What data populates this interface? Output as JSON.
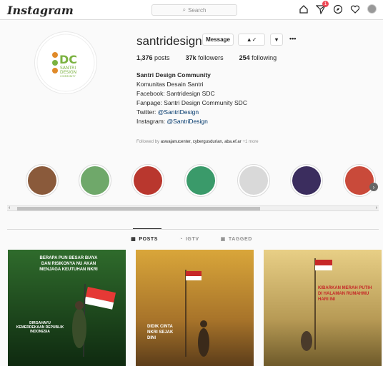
{
  "app": {
    "logo": "Instagram"
  },
  "search": {
    "placeholder": "Search"
  },
  "nav": {
    "activity_count": "1"
  },
  "profile": {
    "username": "santridesign",
    "message_label": "Message",
    "follow_icon_label": "▲✓",
    "more_label": "•••",
    "posts_count": "1,376",
    "posts_label": "posts",
    "followers_count": "37k",
    "followers_label": "followers",
    "following_count": "254",
    "following_label": "following",
    "bio": {
      "name": "Santri Design Community",
      "line1": "Komunitas Desain Santri",
      "line2": "Facebook: Santridesign SDC",
      "line3": "Fanpage: Santri Design Community SDC",
      "twitter_prefix": "Twitter: ",
      "twitter_handle": "@SantriDesign",
      "instagram_prefix": "Instagram: ",
      "instagram_handle": "@SantriDesign",
      "website": "santridesign.id"
    },
    "followed_prefix": "Followed by",
    "followed_users": "aswajanucenter, cybergusdurian, aba.ef.ar",
    "followed_more": "+1 more"
  },
  "highlights": [
    {
      "color": "#8a5a3b"
    },
    {
      "color": "#6fa86a"
    },
    {
      "color": "#b9372e"
    },
    {
      "color": "#3a9a6a"
    },
    {
      "color": "#d9d9d9"
    },
    {
      "color": "#3b2d5e"
    },
    {
      "color": "#c94a3a"
    }
  ],
  "tabs": {
    "posts": "POSTS",
    "igtv": "IGTV",
    "tagged": "TAGGED"
  },
  "posts": [
    {
      "headline": "BERAPA PUN BESAR BIAYA DAN RISIKONYA NU AKAN MENJAGA KEUTUHAN NKRI",
      "footer": "DIRGAHAYU KEMERDEKAAN REPUBLIK INDONESIA"
    },
    {
      "headline": "DIDIK CINTA NKRI SEJAK DINI"
    },
    {
      "headline": "KIBARKAN MERAH PUTIH DI HALAMAN RUMAHMU HARI INI"
    }
  ]
}
